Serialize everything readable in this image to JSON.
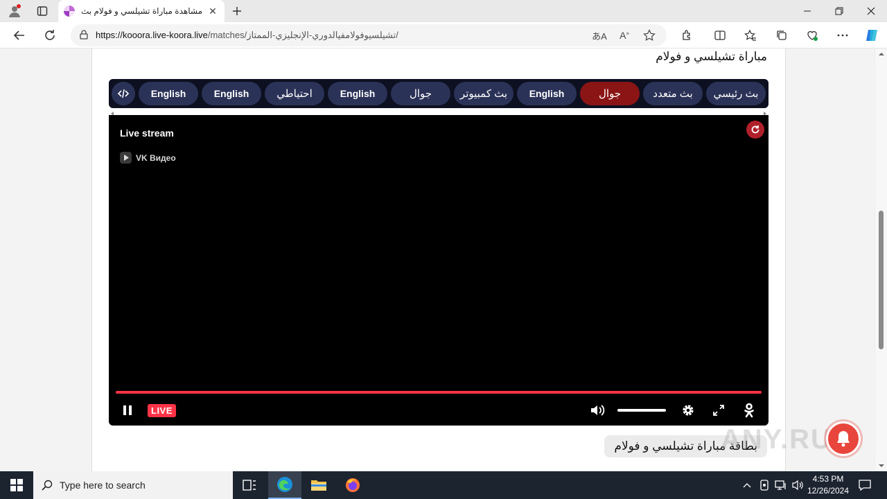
{
  "browser": {
    "tab_title": "مشاهدة مباراة تشيلسي و فولام بث مباشر",
    "url_host": "https://kooora.live-koora.live",
    "url_path": "/matches/تشيلسيوفولامفيالدوري-الإنجليزي-الممتاز/"
  },
  "page": {
    "heading": "مباراة تشيلسي و فولام",
    "servers": [
      {
        "label": "بث رئيسي",
        "active": false
      },
      {
        "label": "بث متعدد",
        "active": false
      },
      {
        "label": "جوال",
        "active": true
      },
      {
        "label": "English",
        "active": false
      },
      {
        "label": "بث كمبيوتر",
        "active": false
      },
      {
        "label": "جوال",
        "active": false
      },
      {
        "label": "English",
        "active": false
      },
      {
        "label": "احتياطي",
        "active": false
      },
      {
        "label": "English",
        "active": false
      },
      {
        "label": "English",
        "active": false
      }
    ],
    "player": {
      "title": "Live stream",
      "provider": "VK Видео",
      "live_badge": "LIVE"
    },
    "card_title": "بطاقة مباراة تشيلسي و فولام"
  },
  "watermark": "ANY.RUN",
  "taskbar": {
    "search_placeholder": "Type here to search",
    "time": "4:53 PM",
    "date": "12/26/2024"
  },
  "colors": {
    "server_bg": "#2b3257",
    "server_active": "#8b1515",
    "live_red": "#ff3347"
  }
}
